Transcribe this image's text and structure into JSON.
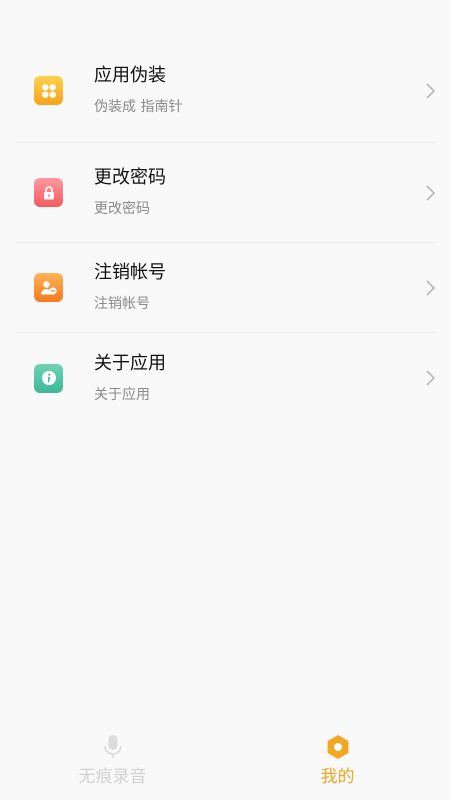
{
  "settings_list": [
    {
      "title": "应用伪装",
      "subtitle": "伪装成 指南针",
      "icon": "grid-icon",
      "color_top": "#ffd24d",
      "color_bottom": "#f7a21b"
    },
    {
      "title": "更改密码",
      "subtitle": "更改密码",
      "icon": "lock-icon",
      "color_top": "#ff9aa0",
      "color_bottom": "#f55a5f"
    },
    {
      "title": "注销帐号",
      "subtitle": "注销帐号",
      "icon": "user-remove-icon",
      "color_top": "#ffb356",
      "color_bottom": "#f77a1e"
    },
    {
      "title": "关于应用",
      "subtitle": "关于应用",
      "icon": "info-icon",
      "color_top": "#6fd3b0",
      "color_bottom": "#3cb89b"
    }
  ],
  "tabbar": {
    "tabs": [
      {
        "label": "无痕录音",
        "icon": "microphone-icon",
        "active": false
      },
      {
        "label": "我的",
        "icon": "hexagon-settings-icon",
        "active": true
      }
    ]
  },
  "colors": {
    "accent": "#f5a623",
    "inactive": "#d2d2d2",
    "background": "#f9f9f9"
  }
}
